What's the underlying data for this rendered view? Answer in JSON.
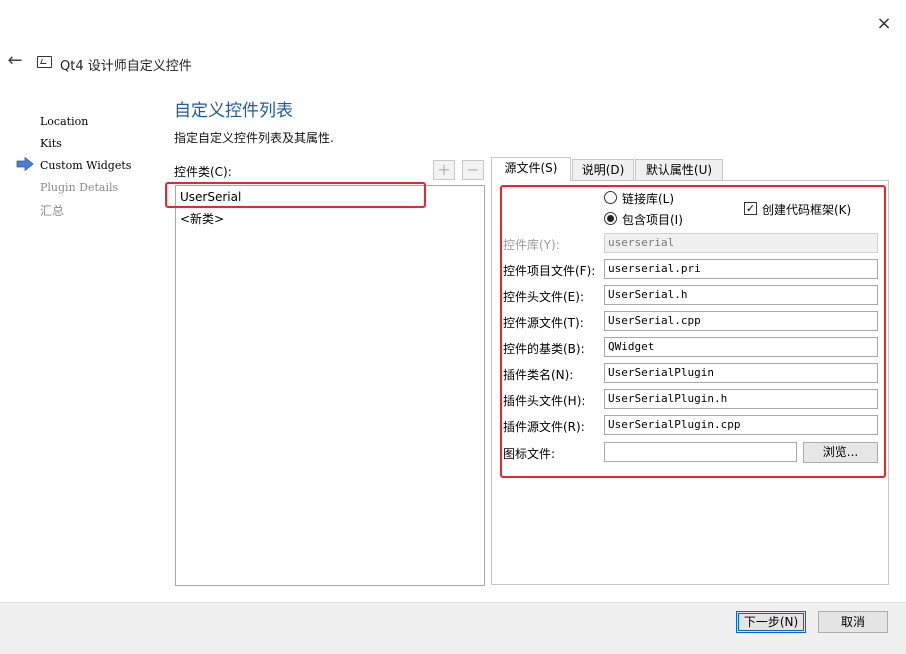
{
  "window": {
    "close_icon": "×",
    "back_icon": "←",
    "title": "Qt4 设计师自定义控件"
  },
  "steps": [
    {
      "label": "Location",
      "state": "done"
    },
    {
      "label": "Kits",
      "state": "done"
    },
    {
      "label": "Custom Widgets",
      "state": "current"
    },
    {
      "label": "Plugin Details",
      "state": "pending"
    },
    {
      "label": "汇总",
      "state": "pending"
    }
  ],
  "page": {
    "title": "自定义控件列表",
    "subtitle": "指定自定义控件列表及其属性."
  },
  "class_list": {
    "label": "控件类(C):",
    "add_icon": "+",
    "remove_icon": "−",
    "items": [
      "UserSerial",
      "<新类>"
    ]
  },
  "tabs": [
    {
      "label": "源文件(S)",
      "active": true
    },
    {
      "label": "说明(D)",
      "active": false
    },
    {
      "label": "默认属性(U)",
      "active": false
    }
  ],
  "options": {
    "link_library": {
      "label": "链接库(L)",
      "checked": false
    },
    "include_project": {
      "label": "包含项目(I)",
      "checked": true
    },
    "create_skeleton": {
      "label": "创建代码框架(K)",
      "checked": true,
      "check_mark": "✓"
    }
  },
  "fields": {
    "library": {
      "label": "控件库(Y):",
      "value": "userserial",
      "enabled": false
    },
    "project_file": {
      "label": "控件项目文件(F):",
      "value": "userserial.pri"
    },
    "header_file": {
      "label": "控件头文件(E):",
      "value": "UserSerial.h"
    },
    "source_file": {
      "label": "控件源文件(T):",
      "value": "UserSerial.cpp"
    },
    "base_class": {
      "label": "控件的基类(B):",
      "value": "QWidget"
    },
    "plugin_class": {
      "label": "插件类名(N):",
      "value": "UserSerialPlugin"
    },
    "plugin_header": {
      "label": "插件头文件(H):",
      "value": "UserSerialPlugin.h"
    },
    "plugin_source": {
      "label": "插件源文件(R):",
      "value": "UserSerialPlugin.cpp"
    },
    "icon_file": {
      "label": "图标文件:",
      "value": ""
    }
  },
  "buttons": {
    "browse": "浏览...",
    "next": "下一步(N)",
    "cancel": "取消"
  },
  "colors": {
    "accent": "#1f5a9a",
    "highlight_box": "#e8262b",
    "step_arrow": "#4a7fd6"
  }
}
